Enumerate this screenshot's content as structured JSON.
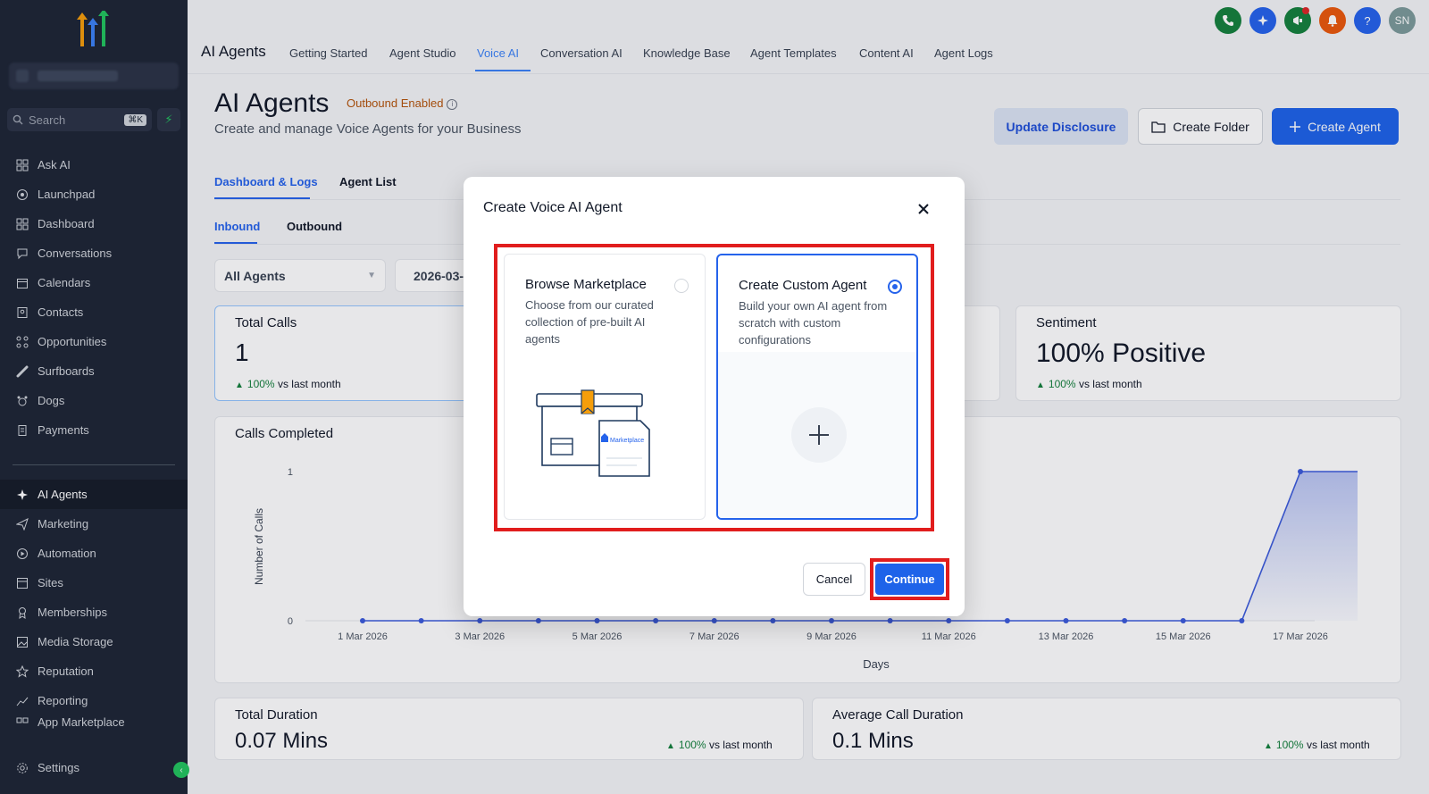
{
  "sidebar": {
    "search_placeholder": "Search",
    "search_shortcut": "⌘K",
    "items": [
      {
        "label": "Ask AI",
        "icon": "grid-icon"
      },
      {
        "label": "Launchpad",
        "icon": "rocket-icon"
      },
      {
        "label": "Dashboard",
        "icon": "grid-icon"
      },
      {
        "label": "Conversations",
        "icon": "chat-icon"
      },
      {
        "label": "Calendars",
        "icon": "calendar-icon"
      },
      {
        "label": "Contacts",
        "icon": "contacts-icon"
      },
      {
        "label": "Opportunities",
        "icon": "opportunities-icon"
      },
      {
        "label": "Surfboards",
        "icon": "surfboard-icon"
      },
      {
        "label": "Dogs",
        "icon": "dog-icon"
      },
      {
        "label": "Payments",
        "icon": "receipt-icon"
      },
      {
        "label": "AI Agents",
        "icon": "sparkle-icon"
      },
      {
        "label": "Marketing",
        "icon": "send-icon"
      },
      {
        "label": "Automation",
        "icon": "automation-icon"
      },
      {
        "label": "Sites",
        "icon": "sites-icon"
      },
      {
        "label": "Memberships",
        "icon": "membership-icon"
      },
      {
        "label": "Media Storage",
        "icon": "image-icon"
      },
      {
        "label": "Reputation",
        "icon": "star-icon"
      },
      {
        "label": "Reporting",
        "icon": "chart-icon"
      },
      {
        "label": "App Marketplace",
        "icon": "apps-icon"
      },
      {
        "label": "Settings",
        "icon": "gear-icon"
      }
    ]
  },
  "topbar": {
    "title": "AI Agents",
    "tabs": [
      "Getting Started",
      "Agent Studio",
      "Voice AI",
      "Conversation AI",
      "Knowledge Base",
      "Agent Templates",
      "Content AI",
      "Agent Logs"
    ],
    "active_tab": "Voice AI",
    "avatar_initials": "SN",
    "help_label": "?",
    "colors": {
      "phone": "#15803d",
      "sparkle": "#2563eb",
      "megaphone": "#15803d",
      "bell": "#ea580c",
      "help": "#2563eb",
      "avatar": "#7c9a9a"
    }
  },
  "header": {
    "title": "AI Agents",
    "badge": "Outbound Enabled",
    "badge_info": "i",
    "subtitle": "Create and manage Voice Agents for your Business",
    "update_disclosure": "Update Disclosure",
    "create_folder": "Create Folder",
    "create_agent": "Create Agent"
  },
  "tabs": {
    "dashboard": "Dashboard & Logs",
    "agent_list": "Agent List"
  },
  "subtabs": {
    "inbound": "Inbound",
    "outbound": "Outbound"
  },
  "filters": {
    "agent": "All Agents",
    "date": "2026-03-"
  },
  "stats": {
    "total_calls": {
      "label": "Total Calls",
      "value": "1",
      "trend_pct": "100%",
      "trend_text": "vs last month"
    },
    "sentiment": {
      "label": "Sentiment",
      "value": "100% Positive",
      "trend_pct": "100%",
      "trend_text": "vs last month"
    },
    "total_duration": {
      "label": "Total Duration",
      "value": "0.07 Mins",
      "trend_pct": "100%",
      "trend_text": "vs last month"
    },
    "avg_duration": {
      "label": "Average Call Duration",
      "value": "0.1 Mins",
      "trend_pct": "100%",
      "trend_text": "vs last month"
    }
  },
  "chart_data": {
    "type": "area",
    "title": "Calls Completed",
    "xlabel": "Days",
    "ylabel": "Number of Calls",
    "ylim": [
      0,
      1
    ],
    "yticks": [
      "0",
      "1"
    ],
    "x": [
      "1 Mar 2026",
      "2 Mar 2026",
      "3 Mar 2026",
      "4 Mar 2026",
      "5 Mar 2026",
      "6 Mar 2026",
      "7 Mar 2026",
      "8 Mar 2026",
      "9 Mar 2026",
      "10 Mar 2026",
      "11 Mar 2026",
      "12 Mar 2026",
      "13 Mar 2026",
      "14 Mar 2026",
      "15 Mar 2026",
      "16 Mar 2026",
      "17 Mar 2026"
    ],
    "xticks": [
      "1 Mar 2026",
      "3 Mar 2026",
      "5 Mar 2026",
      "7 Mar 2026",
      "9 Mar 2026",
      "11 Mar 2026",
      "13 Mar 2026",
      "15 Mar 2026",
      "17 Mar 2026"
    ],
    "values": [
      0,
      0,
      0,
      0,
      0,
      0,
      0,
      0,
      0,
      0,
      0,
      0,
      0,
      0,
      0,
      0,
      1
    ],
    "color": "#3b5bdb"
  },
  "modal": {
    "title": "Create Voice AI Agent",
    "options": [
      {
        "title": "Browse Marketplace",
        "description": "Choose from our curated collection of pre-built AI agents",
        "selected": false,
        "illustration_text": "Marketplace"
      },
      {
        "title": "Create Custom Agent",
        "description": "Build your own AI agent from scratch with custom configurations",
        "selected": true
      }
    ],
    "cancel": "Cancel",
    "continue": "Continue",
    "highlight_color": "#e11d1d"
  }
}
